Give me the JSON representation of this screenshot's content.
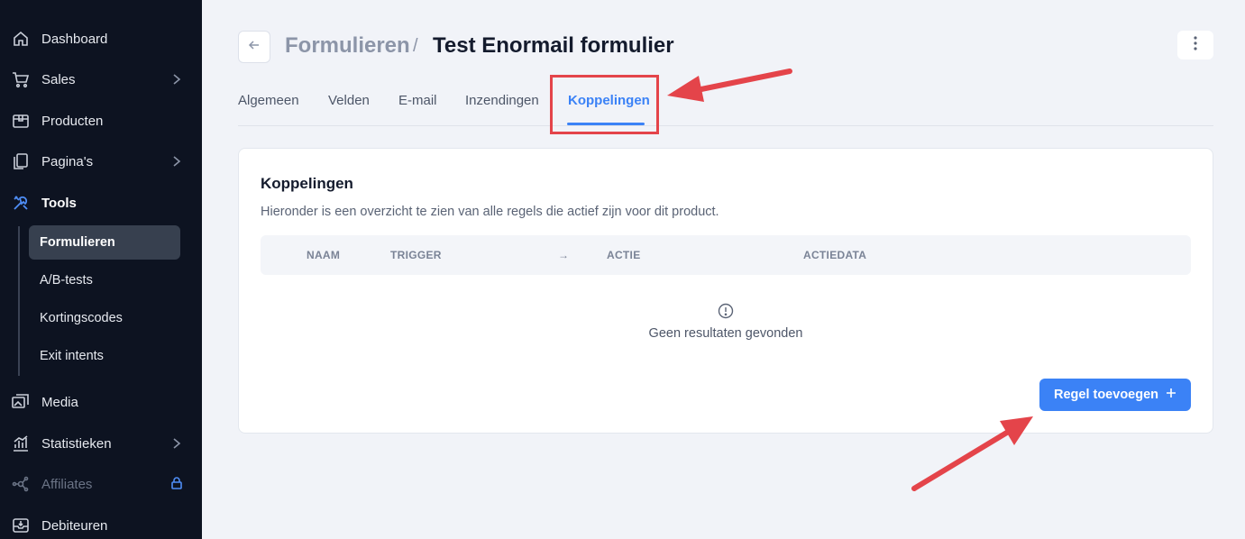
{
  "sidebar": {
    "items": [
      {
        "label": "Dashboard",
        "icon": "home-icon"
      },
      {
        "label": "Sales",
        "icon": "cart-icon"
      },
      {
        "label": "Producten",
        "icon": "box-icon"
      },
      {
        "label": "Pagina's",
        "icon": "pages-icon"
      },
      {
        "label": "Tools",
        "icon": "tools-icon"
      },
      {
        "label": "Media",
        "icon": "media-icon"
      },
      {
        "label": "Statistieken",
        "icon": "chart-icon"
      },
      {
        "label": "Affiliates",
        "icon": "network-icon"
      },
      {
        "label": "Debiteuren",
        "icon": "inbox-icon"
      }
    ],
    "tools_sub": [
      {
        "label": "Formulieren",
        "active": true
      },
      {
        "label": "A/B-tests"
      },
      {
        "label": "Kortingscodes"
      },
      {
        "label": "Exit intents"
      }
    ]
  },
  "header": {
    "breadcrumb_parent": "Formulieren",
    "separator": "/",
    "title": "Test Enormail formulier"
  },
  "tabs": [
    {
      "label": "Algemeen"
    },
    {
      "label": "Velden"
    },
    {
      "label": "E-mail"
    },
    {
      "label": "Inzendingen"
    },
    {
      "label": "Koppelingen",
      "active": true
    }
  ],
  "card": {
    "title": "Koppelingen",
    "description": "Hieronder is een overzicht te zien van alle regels die actief zijn voor dit product.",
    "columns": [
      "NAAM",
      "TRIGGER",
      "→",
      "ACTIE",
      "ACTIEDATA"
    ],
    "empty_text": "Geen resultaten gevonden",
    "add_button": "Regel toevoegen"
  },
  "colors": {
    "sidebar_bg": "#0d1321",
    "accent": "#3b82f6",
    "annotation": "#e4444a",
    "page_bg": "#f1f3f8"
  }
}
